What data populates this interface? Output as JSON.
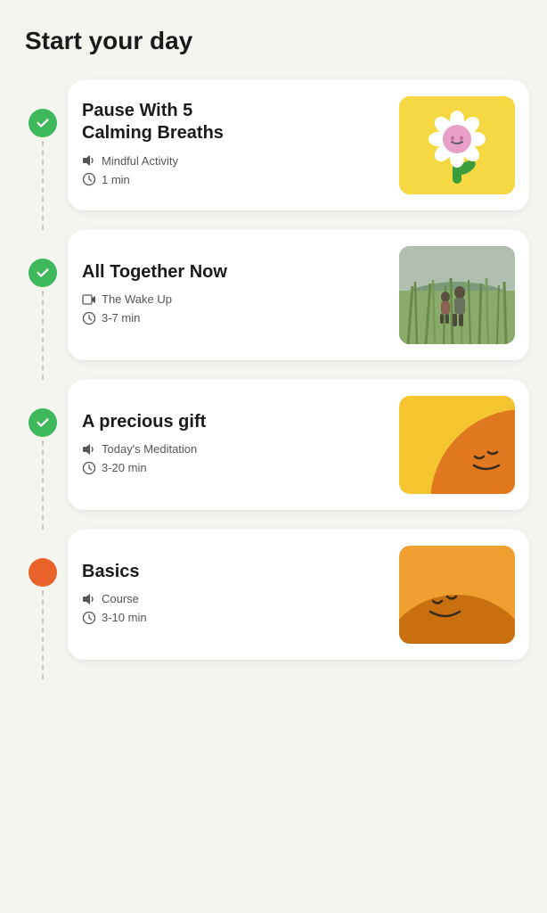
{
  "page": {
    "title": "Start your day"
  },
  "cards": [
    {
      "id": "pause-with-5",
      "title_line1": "Pause With 5",
      "title_line2": "Calming Breaths",
      "category_icon": "volume-icon",
      "category": "Mindful Activity",
      "time_icon": "clock-icon",
      "duration": "1 min",
      "image_type": "flower",
      "status": "completed"
    },
    {
      "id": "all-together-now",
      "title_line1": "All Together Now",
      "title_line2": "",
      "category_icon": "video-icon",
      "category": "The Wake Up",
      "time_icon": "clock-icon",
      "duration": "3-7 min",
      "image_type": "photo",
      "status": "completed"
    },
    {
      "id": "precious-gift",
      "title_line1": "A precious gift",
      "title_line2": "",
      "category_icon": "volume-icon",
      "category": "Today's Meditation",
      "time_icon": "clock-icon",
      "duration": "3-20 min",
      "image_type": "sun",
      "status": "completed"
    },
    {
      "id": "basics",
      "title_line1": "Basics",
      "title_line2": "",
      "category_icon": "volume-icon",
      "category": "Course",
      "time_icon": "clock-icon",
      "duration": "3-10 min",
      "image_type": "basics",
      "status": "current"
    }
  ]
}
